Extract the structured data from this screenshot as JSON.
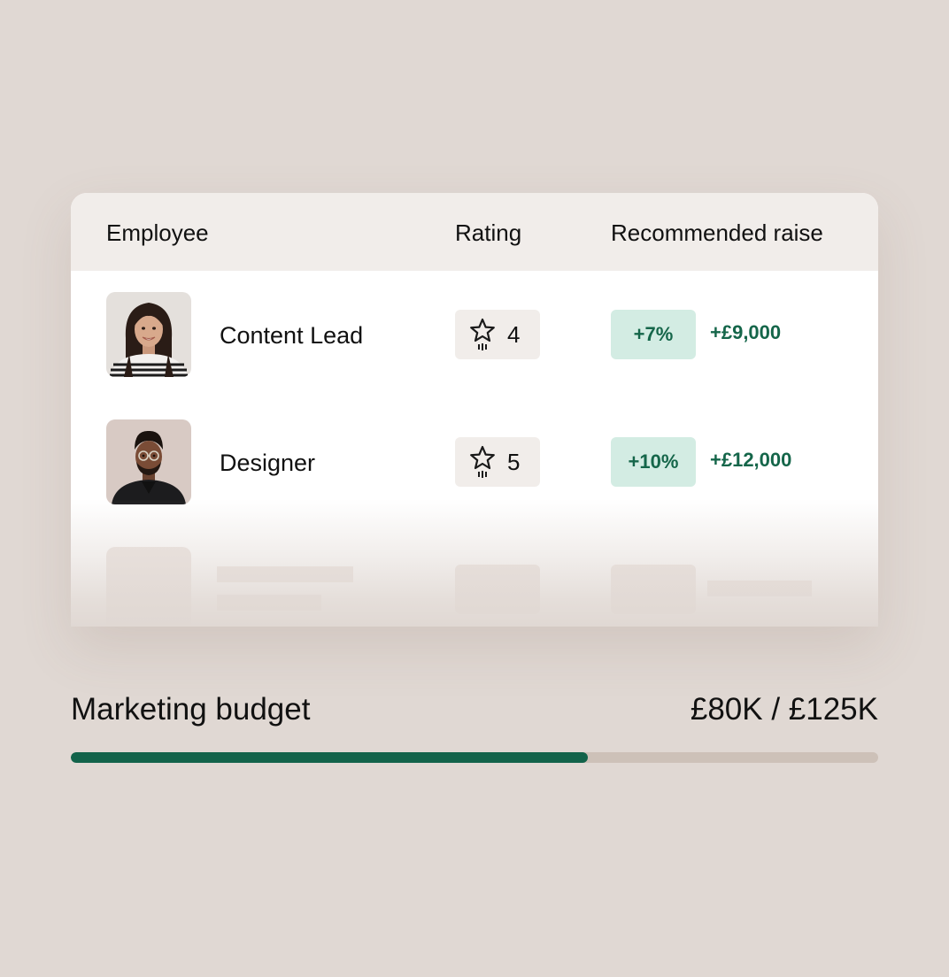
{
  "table": {
    "headers": {
      "employee": "Employee",
      "rating": "Rating",
      "raise": "Recommended raise"
    },
    "rows": [
      {
        "name": "Content Lead",
        "rating": "4",
        "raise_percent": "+7%",
        "raise_amount": "+£9,000",
        "avatar": "woman-portrait"
      },
      {
        "name": "Designer",
        "rating": "5",
        "raise_percent": "+10%",
        "raise_amount": "+£12,000",
        "avatar": "man-portrait"
      }
    ]
  },
  "budget": {
    "label": "Marketing budget",
    "value": "£80K / £125K",
    "used_fraction": 0.64
  },
  "icons": {
    "rating": "star-rising-icon"
  },
  "colors": {
    "accent_green": "#12634a",
    "raise_chip_bg": "#d3ece3",
    "raise_text": "#15664a",
    "progress_track": "#cdc1b8",
    "page_bg": "#e0d8d3"
  }
}
